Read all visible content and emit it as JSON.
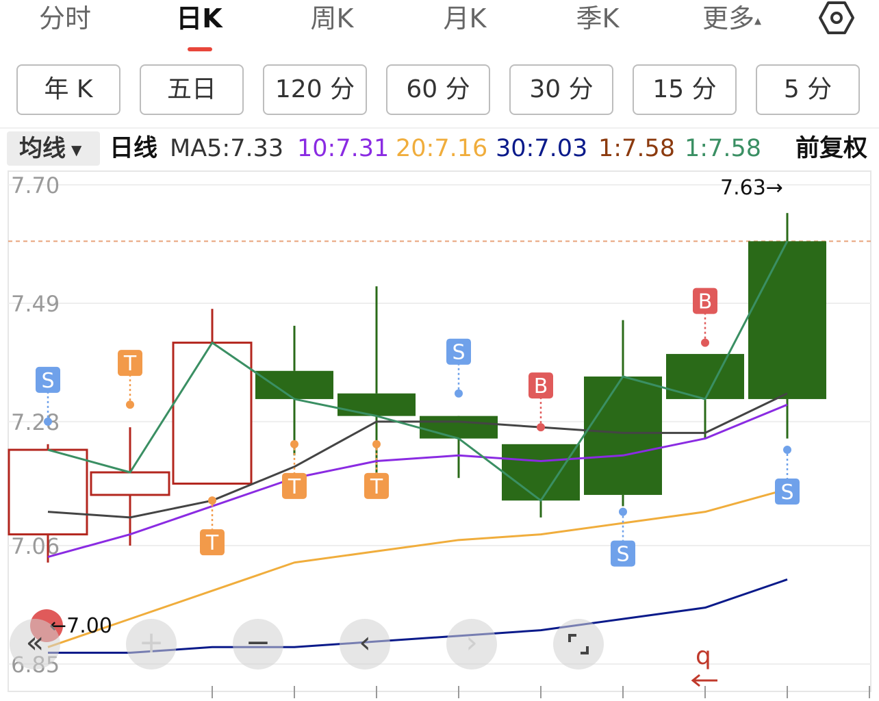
{
  "tabs": [
    {
      "label": "分时"
    },
    {
      "label": "日K"
    },
    {
      "label": "周K"
    },
    {
      "label": "月K"
    },
    {
      "label": "季K"
    },
    {
      "label": "更多"
    }
  ],
  "more_caret": "▴",
  "settings_icon": "gear-hexagon-icon",
  "periods": [
    {
      "label": "年 K"
    },
    {
      "label": "五日"
    },
    {
      "label": "120 分"
    },
    {
      "label": "60 分"
    },
    {
      "label": "30 分"
    },
    {
      "label": "15 分"
    },
    {
      "label": "5 分"
    }
  ],
  "ma_bar": {
    "selector": "均线",
    "period": "日线",
    "ma5": "MA5:7.33",
    "ma10": "10:7.31",
    "ma20": "20:7.16",
    "ma30": "30:7.03",
    "ma_a": "1:7.58",
    "ma_b": "1:7.58",
    "adjust": "前复权",
    "colors": {
      "ma5": "#333333",
      "ma10": "#8a2be2",
      "ma20": "#f0ad3c",
      "ma30": "#0a1a8a",
      "ma_a": "#8b3a0e",
      "ma_b": "#3a8f63"
    }
  },
  "chart_data": {
    "type": "candlestick",
    "y_ticks": [
      "7.70",
      "7.49",
      "7.28",
      "7.06",
      "6.85"
    ],
    "ylim": [
      6.85,
      7.7
    ],
    "up_color": "#b3261e",
    "down_color": "#2a6a18",
    "max_label": "7.63→",
    "min_label": "←7.00",
    "reference_line": 7.6,
    "candles": [
      {
        "open": 7.08,
        "close": 7.23,
        "high": 7.24,
        "low": 7.03
      },
      {
        "open": 7.15,
        "close": 7.19,
        "high": 7.27,
        "low": 7.06
      },
      {
        "open": 7.17,
        "close": 7.42,
        "high": 7.48,
        "low": 7.17
      },
      {
        "open": 7.37,
        "close": 7.32,
        "high": 7.45,
        "low": 7.22
      },
      {
        "open": 7.33,
        "close": 7.29,
        "high": 7.52,
        "low": 7.18
      },
      {
        "open": 7.29,
        "close": 7.25,
        "high": 7.25,
        "low": 7.18
      },
      {
        "open": 7.24,
        "close": 7.14,
        "high": 7.24,
        "low": 7.11
      },
      {
        "open": 7.36,
        "close": 7.15,
        "high": 7.46,
        "low": 7.13
      },
      {
        "open": 7.4,
        "close": 7.32,
        "high": 7.4,
        "low": 7.25
      },
      {
        "open": 7.6,
        "close": 7.32,
        "high": 7.65,
        "low": 7.25
      }
    ],
    "series": [
      {
        "values": [
          7.12,
          7.11,
          7.14,
          7.2,
          7.28,
          7.28,
          7.27,
          7.26,
          7.26,
          7.33
        ]
      },
      {
        "values": [
          7.04,
          7.08,
          7.13,
          7.18,
          7.21,
          7.22,
          7.21,
          7.22,
          7.25,
          7.31
        ]
      },
      {
        "values": [
          6.88,
          6.93,
          6.98,
          7.03,
          7.05,
          7.07,
          7.08,
          7.1,
          7.12,
          7.16
        ]
      },
      {
        "values": [
          6.87,
          6.87,
          6.88,
          6.88,
          6.89,
          6.9,
          6.91,
          6.93,
          6.95,
          7.0
        ]
      },
      {
        "values": [
          7.23,
          7.19,
          7.42,
          7.32,
          7.29,
          7.25,
          7.14,
          7.36,
          7.32,
          7.6
        ]
      }
    ],
    "markers": [
      {
        "index": 0,
        "label": "S",
        "kind": "S",
        "anchor": 7.28,
        "side": "above"
      },
      {
        "index": 1,
        "label": "T",
        "kind": "T",
        "anchor": 7.31,
        "side": "above"
      },
      {
        "index": 2,
        "label": "T",
        "kind": "T",
        "anchor": 7.14,
        "side": "below"
      },
      {
        "index": 3,
        "label": "T",
        "kind": "T",
        "anchor": 7.24,
        "side": "below"
      },
      {
        "index": 4,
        "label": "T",
        "kind": "T",
        "anchor": 7.24,
        "side": "below"
      },
      {
        "index": 5,
        "label": "S",
        "kind": "S",
        "anchor": 7.33,
        "side": "above"
      },
      {
        "index": 6,
        "label": "B",
        "kind": "B",
        "anchor": 7.27,
        "side": "above"
      },
      {
        "index": 7,
        "label": "S",
        "kind": "S",
        "anchor": 7.12,
        "side": "below"
      },
      {
        "index": 8,
        "label": "B",
        "kind": "B",
        "anchor": 7.42,
        "side": "above"
      },
      {
        "index": 9,
        "label": "S",
        "kind": "S",
        "anchor": 7.23,
        "side": "below"
      }
    ],
    "marker_colors": {
      "S": "#6fa1ea",
      "T": "#f29a4a",
      "B": "#e05a5a"
    }
  },
  "controls": {
    "rewind": "«",
    "zoom_in": "+",
    "zoom_out": "−",
    "prev": "‹",
    "next": "›",
    "fullscreen_icon": "fullscreen-icon"
  },
  "corner_glyph": "q"
}
